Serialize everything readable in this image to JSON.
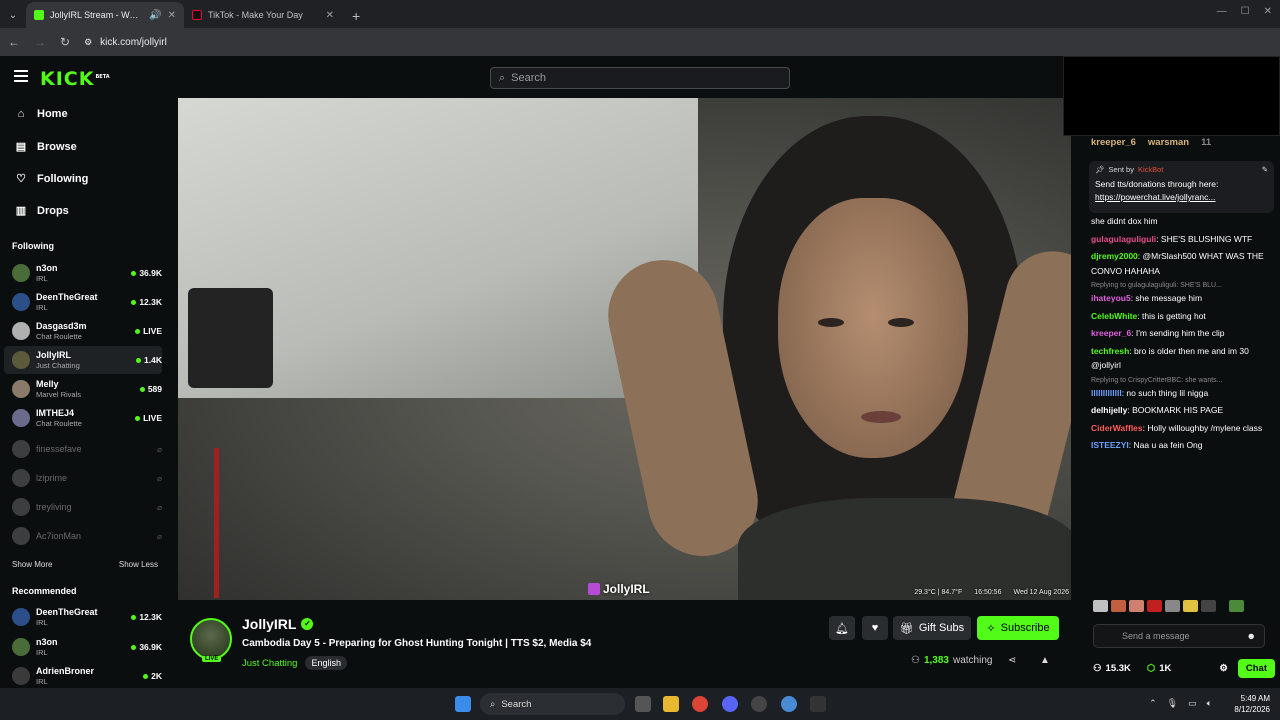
{
  "browser": {
    "tabs": [
      {
        "title": "JollyIRL Stream - Watch Live",
        "favicon_color": "#53fc18",
        "audio_icon": "speaker-icon"
      },
      {
        "title": "TikTok - Make Your Day",
        "favicon_color": "#111111"
      }
    ],
    "new_tab": "+",
    "url": "kick.com/jollyirl"
  },
  "header": {
    "logo": "KICK",
    "logo_badge": "BETA",
    "search_placeholder": "Search"
  },
  "sidebar": {
    "nav": [
      {
        "label": "Home",
        "icon": "home-icon"
      },
      {
        "label": "Browse",
        "icon": "browse-icon"
      },
      {
        "label": "Following",
        "icon": "heart-icon"
      },
      {
        "label": "Drops",
        "icon": "drops-icon"
      }
    ],
    "following_title": "Following",
    "following": [
      {
        "name": "n3on",
        "category": "IRL",
        "viewers": "36.9K",
        "avatar": "#4a6b3a"
      },
      {
        "name": "DeenTheGreat",
        "category": "IRL",
        "viewers": "12.3K",
        "avatar": "#2c4f8a"
      },
      {
        "name": "Dasgasd3m",
        "category": "Chat Roulette",
        "viewers": "LIVE",
        "avatar": "#b0b0b0"
      },
      {
        "name": "JollyIRL",
        "category": "Just Chatting",
        "viewers": "1.4K",
        "avatar": "#5a5a3a"
      },
      {
        "name": "Melly",
        "category": "Marvel Rivals",
        "viewers": "589",
        "avatar": "#8a7a6a"
      },
      {
        "name": "IMTHEJ4",
        "category": "Chat Roulette",
        "viewers": "LIVE",
        "avatar": "#6a6a8a"
      }
    ],
    "offline": [
      "finessefave",
      "lziprime",
      "treyliving",
      "Ac7ionMan"
    ],
    "show_more": "Show More",
    "show_less": "Show Less",
    "recommended_title": "Recommended",
    "recommended": [
      {
        "name": "DeenTheGreat",
        "category": "IRL",
        "viewers": "12.3K",
        "avatar": "#2c4f8a"
      },
      {
        "name": "n3on",
        "category": "IRL",
        "viewers": "36.9K",
        "avatar": "#4a6b3a"
      },
      {
        "name": "AdrienBroner",
        "category": "IRL",
        "viewers": "2K",
        "avatar": "#3a3a3a"
      }
    ]
  },
  "video": {
    "watermark": "JollyIRL",
    "status": [
      "29.3°C | 84.7°F",
      "16:50:56",
      "Wed 12 Aug 2026"
    ]
  },
  "stream": {
    "name": "JollyIRL",
    "title": "Cambodia Day 5 - Preparing for Ghost Hunting Tonight | TTS $2, Media $4",
    "category": "Just Chatting",
    "tag": "English",
    "live_badge": "LIVE",
    "gift_label": "Gift Subs",
    "subscribe_label": "Subscribe",
    "viewers": "1,383",
    "watching_label": "watching"
  },
  "chat": {
    "top_gifters": [
      "kreeper_6",
      "warsman",
      "11"
    ],
    "pinned": {
      "sent_by": "Sent by",
      "sender": "KickBot",
      "text": "Send tts/donations through here:",
      "link": "https://powerchat.live/jollyranc..."
    },
    "messages": [
      {
        "reply": "",
        "user": "",
        "color": "#ffffff",
        "text": "she didnt dox him"
      },
      {
        "reply": "",
        "user": "gulagulaguliguli",
        "color": "#e74c8c",
        "text": ": SHE'S BLUSHING WTF"
      },
      {
        "reply": "",
        "user": "djremy2000",
        "color": "#53fc18",
        "text": ": @MrSlash500 WHAT WAS THE CONVO HAHAHA"
      },
      {
        "reply": "Replying to gulagulaguliguli: SHE'S BLU...",
        "user": "ihateyou5",
        "color": "#e060e0",
        "text": ": she message him"
      },
      {
        "reply": "",
        "user": "CelebWhite",
        "color": "#53fc18",
        "text": ": this is getting hot"
      },
      {
        "reply": "",
        "user": "kreeper_6",
        "color": "#e060e0",
        "text": ": I'm sending him the clip"
      },
      {
        "reply": "",
        "user": "techfresh",
        "color": "#53fc18",
        "text": ": bro is older then me and im 30 @jollyirl"
      },
      {
        "reply": "Replying to CrispyCritterBBC: she wants...",
        "user": "lllllllllllll",
        "color": "#6aa0ff",
        "text": ": no such thing lil nigga"
      },
      {
        "reply": "",
        "user": "delhijelly",
        "color": "#ffffff",
        "text": ": BOOKMARK HIS PAGE"
      },
      {
        "reply": "",
        "user": "CiderWaffles",
        "color": "#ff5b5b",
        "text": ": Holly willoughby /mylene class"
      },
      {
        "reply": "",
        "user": "ISTEEZYI",
        "color": "#6aa0ff",
        "text": ": Naa u aa fein Ong"
      }
    ],
    "send_placeholder": "Send a message",
    "followers": "15.3K",
    "subs": "1K",
    "chat_button": "Chat"
  },
  "taskbar": {
    "search": "Search",
    "time": "5:49 AM",
    "date": "8/12/2026"
  }
}
